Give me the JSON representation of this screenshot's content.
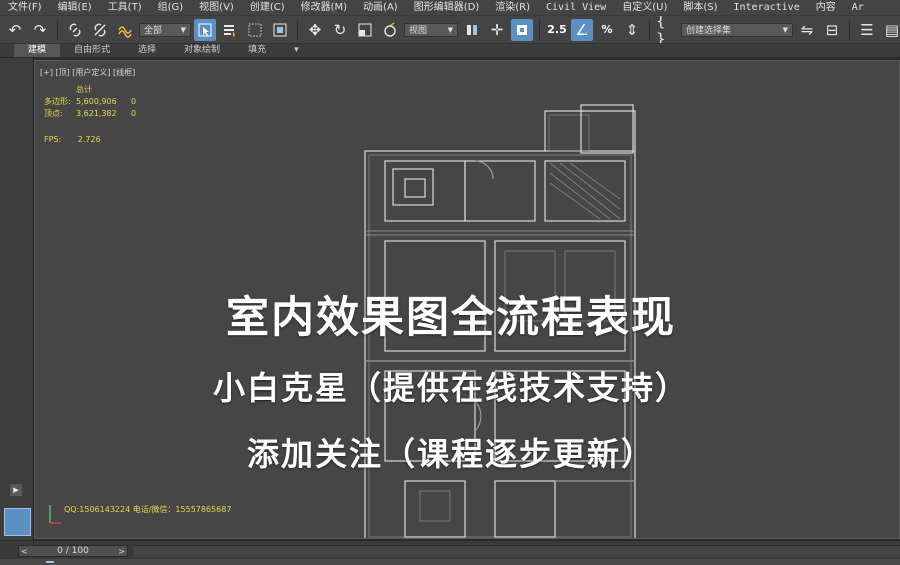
{
  "menu": [
    {
      "label": "文件(F)",
      "mono": false
    },
    {
      "label": "编辑(E)",
      "mono": false
    },
    {
      "label": "工具(T)",
      "mono": false
    },
    {
      "label": "组(G)",
      "mono": false
    },
    {
      "label": "视图(V)",
      "mono": false
    },
    {
      "label": "创建(C)",
      "mono": false
    },
    {
      "label": "修改器(M)",
      "mono": false
    },
    {
      "label": "动画(A)",
      "mono": false
    },
    {
      "label": "图形编辑器(D)",
      "mono": false
    },
    {
      "label": "渲染(R)",
      "mono": false
    },
    {
      "label": "Civil View",
      "mono": true
    },
    {
      "label": "自定义(U)",
      "mono": false
    },
    {
      "label": "脚本(S)",
      "mono": false
    },
    {
      "label": "Interactive",
      "mono": true
    },
    {
      "label": "内容",
      "mono": false
    },
    {
      "label": "Ar",
      "mono": true
    }
  ],
  "toolbar": {
    "filter_value": "全部",
    "view_dropdown": "视图",
    "selection_set": "创建选择集",
    "snap_2_5": "2.5",
    "percent_snap": "%"
  },
  "ribbon": {
    "tabs": [
      "建模",
      "自由形式",
      "选择",
      "对象绘制",
      "填充"
    ]
  },
  "viewport": {
    "label": "[+] [顶] [用户定义] [线框]",
    "stats": {
      "header": "总计",
      "polys_label": "多边形:",
      "polys_value": "5,600,906",
      "polys_sel": "0",
      "verts_label": "顶点:",
      "verts_value": "3,621,382",
      "verts_sel": "0",
      "fps_label": "FPS:",
      "fps_value": "2.726"
    },
    "overlay": {
      "line1": "室内效果图全流程表现",
      "line2": "小白克星（提供在线技术支持）",
      "line3": "添加关注（课程逐步更新）"
    },
    "contact": "QQ:1506143224   电话/微信：15557865687",
    "axis": {
      "x": "X",
      "y": "Y"
    }
  },
  "timeline": {
    "frame_label": "0 / 100"
  },
  "colors": {
    "accent": "#5c8fc3",
    "stats_yellow": "#e9d84a",
    "viewport_bg": "#464646"
  }
}
